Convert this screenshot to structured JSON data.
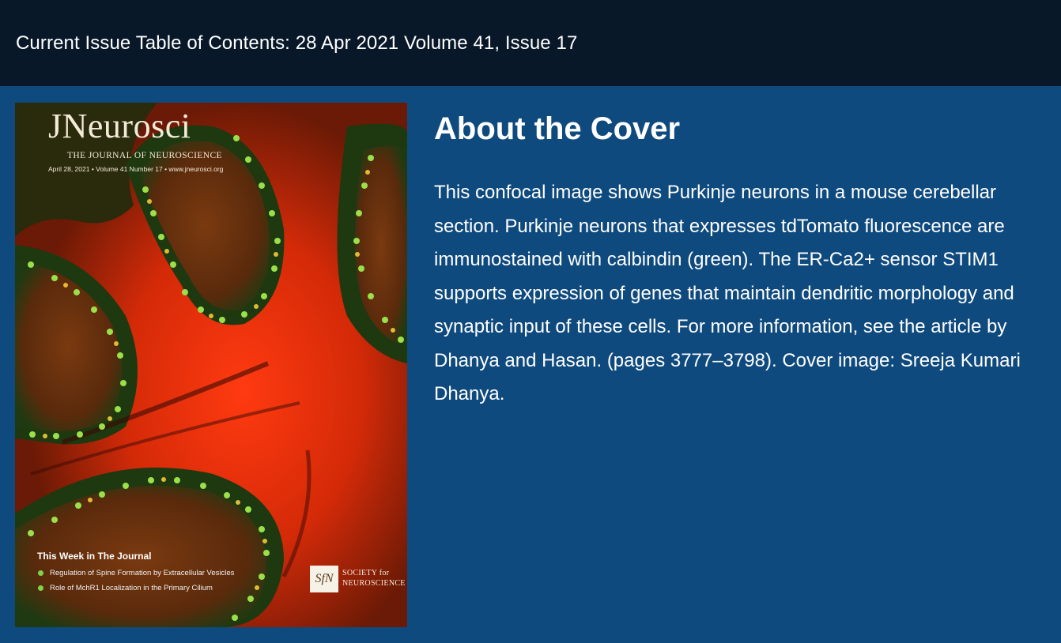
{
  "header": {
    "title": "Current Issue Table of Contents: 28 Apr 2021 Volume 41, Issue 17"
  },
  "cover": {
    "masthead": "JNeurosci",
    "subtitle": "THE JOURNAL OF NEUROSCIENCE",
    "dateline": "April 28, 2021 • Volume 41 Number 17 • www.jneurosci.org",
    "this_week_title": "This Week in The Journal",
    "this_week_items": [
      "Regulation of Spine Formation by Extracellular Vesicles",
      "Role of MchR1 Localization in the Primary Cilium"
    ],
    "sfn_logo": "SfN",
    "sfn_line1": "SOCIETY for",
    "sfn_line2": "NEUROSCIENCE"
  },
  "about": {
    "heading": "About the Cover",
    "body": "This confocal image shows Purkinje neurons in a mouse cerebellar section. Purkinje neurons that expresses tdTomato fluorescence are immunostained with calbindin (green). The ER-Ca2+ sensor STIM1 supports expression of genes that maintain dendritic morphology and synaptic input of these cells. For more information, see the article by Dhanya and Hasan. (pages 3777–3798). Cover image: Sreeja Kumari Dhanya."
  },
  "colors": {
    "header_bg": "#081829",
    "page_bg": "#0f4a7e",
    "text": "#ffffff"
  }
}
